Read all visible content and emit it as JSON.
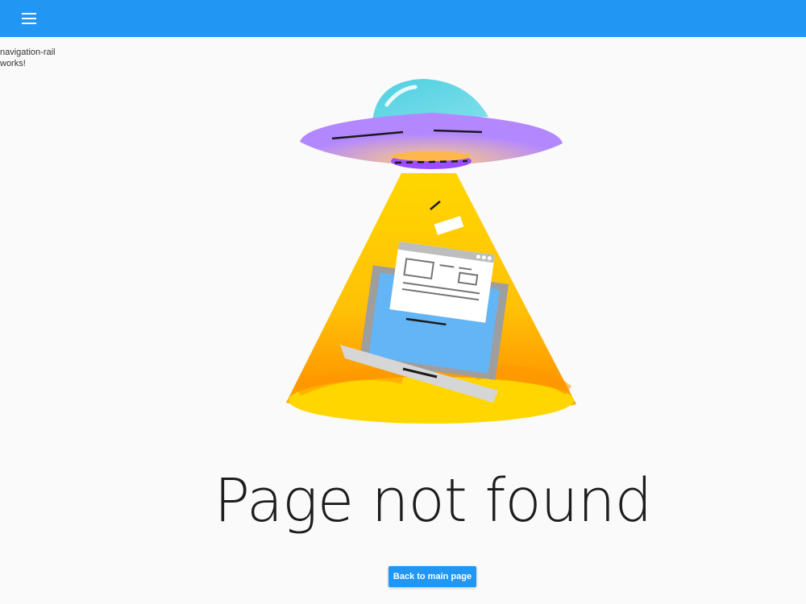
{
  "header": {
    "menu_icon": "hamburger-menu-icon",
    "color": "#2196f3"
  },
  "nav_rail": {
    "text": "navigation-rail works!"
  },
  "illustration": {
    "subject": "ufo-abducting-laptop"
  },
  "main": {
    "title": "Page not found",
    "back_button_label": "Back to main page"
  }
}
